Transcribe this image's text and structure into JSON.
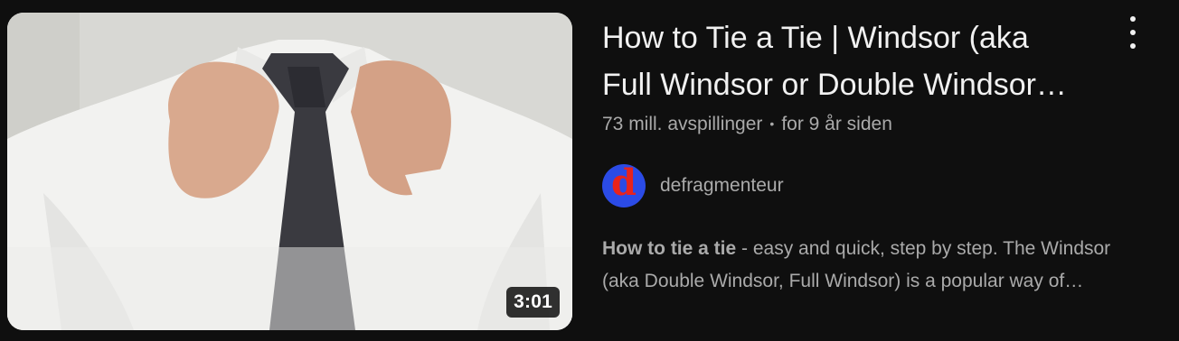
{
  "video": {
    "title_line1": "How to Tie a Tie | Windsor (aka",
    "title_line2": "Full Windsor or Double Windsor…",
    "duration": "3:01",
    "views": "73 mill. avspillinger",
    "separator": "•",
    "age": "for 9 år siden",
    "channel": {
      "name": "defragmenteur",
      "avatar_letter": "d",
      "avatar_bg": "#2b4be6",
      "avatar_fg": "#e8231c"
    },
    "description": {
      "bold": "How to tie a tie",
      "rest_line1": " - easy and quick, step by step. The Windsor",
      "line2": "(aka Double Windsor, Full Windsor) is a popular way of…"
    },
    "more_icon": "vertical-ellipsis-icon"
  },
  "colors": {
    "background": "#0f0f0f",
    "title": "#f1f1f1",
    "secondary_text": "#aaaaaa"
  }
}
